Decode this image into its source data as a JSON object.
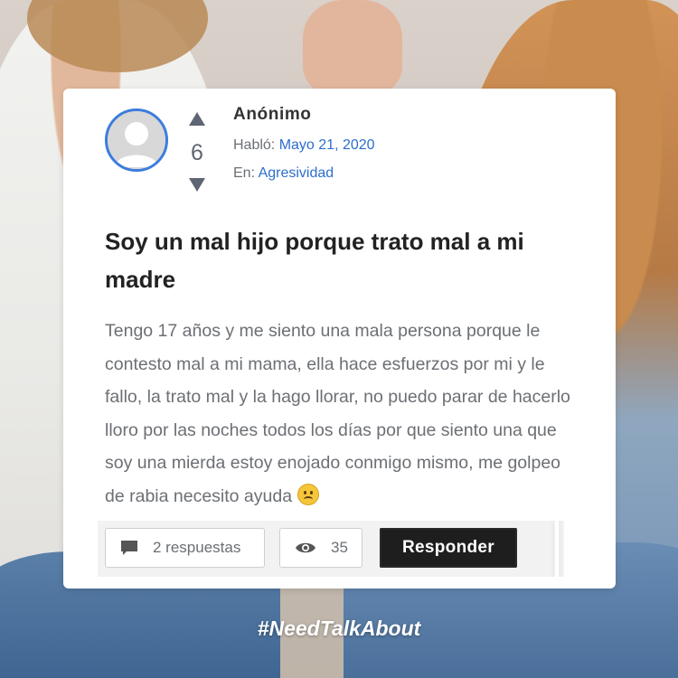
{
  "post": {
    "author": "Anónimo",
    "spoke_label": "Habló:",
    "date": "Mayo 21, 2020",
    "category_label": "En:",
    "category": "Agresividad",
    "votes": "6",
    "title": "Soy un mal hijo porque trato mal a mi madre",
    "body": "Tengo 17 años y me siento una mala persona porque le contesto mal a mi mama, ella hace esfuerzos por mi y le fallo, la trato mal y la hago llorar, no puedo parar de hacerlo lloro por las noches todos los días por que siento una que soy una mierda estoy enojado conmigo mismo, me golpeo de rabia necesito ayuda",
    "emoji": "slightly-frowning-face-icon"
  },
  "actions": {
    "replies_label": "2 respuestas",
    "views": "35",
    "respond_label": "Responder"
  },
  "hashtag": "#NeedTalkAbout",
  "colors": {
    "accent": "#3b7ddd",
    "link": "#2c6fcc",
    "button_bg": "#1e1e1e",
    "card_bg": "#ffffff"
  },
  "icons": {
    "avatar": "user-placeholder-icon",
    "upvote": "triangle-up-icon",
    "downvote": "triangle-down-icon",
    "replies": "speech-bubble-icon",
    "views": "eye-icon"
  }
}
